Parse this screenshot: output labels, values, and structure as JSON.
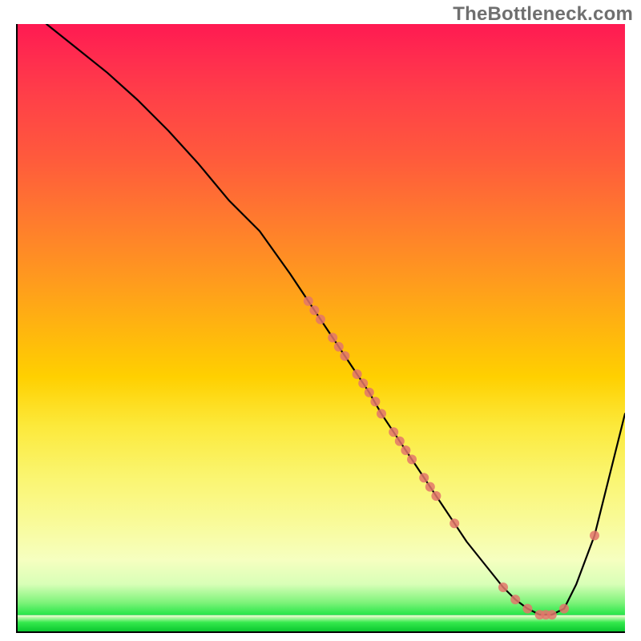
{
  "attribution": "TheBottleneck.com",
  "colors": {
    "curve": "#000000",
    "marker_fill": "#e3766b",
    "marker_stroke": "#b84a44"
  },
  "chart_data": {
    "type": "line",
    "title": "",
    "xlabel": "",
    "ylabel": "",
    "xlim": [
      0,
      100
    ],
    "ylim": [
      0,
      100
    ],
    "grid": false,
    "legend": false,
    "series": [
      {
        "name": "bottleneck-curve",
        "x": [
          5,
          10,
          15,
          20,
          25,
          30,
          35,
          40,
          45,
          48,
          50,
          52,
          55,
          58,
          60,
          62,
          65,
          68,
          70,
          72,
          74,
          76,
          78,
          80,
          82,
          84,
          86,
          88,
          90,
          92,
          95,
          100
        ],
        "y": [
          100,
          96,
          92,
          87.5,
          82.5,
          77,
          71,
          66,
          59,
          54.5,
          51.5,
          48.5,
          44,
          39.5,
          36,
          33,
          28.5,
          24,
          21,
          18,
          15,
          12.5,
          10,
          7.5,
          5.5,
          4,
          3,
          3,
          4,
          8,
          16,
          36
        ]
      }
    ],
    "markers": {
      "name": "highlighted-points",
      "x": [
        48,
        49,
        50,
        52,
        53,
        54,
        56,
        57,
        58,
        59,
        60,
        62,
        63,
        64,
        65,
        67,
        68,
        69,
        72,
        80,
        82,
        84,
        86,
        87,
        88,
        90,
        95
      ],
      "y": [
        54.5,
        53,
        51.5,
        48.5,
        47,
        45.5,
        42.5,
        41,
        39.5,
        38,
        36,
        33,
        31.5,
        30,
        28.5,
        25.5,
        24,
        22.5,
        18,
        7.5,
        5.5,
        4,
        3,
        3,
        3,
        4,
        16
      ],
      "radius": 6
    }
  }
}
